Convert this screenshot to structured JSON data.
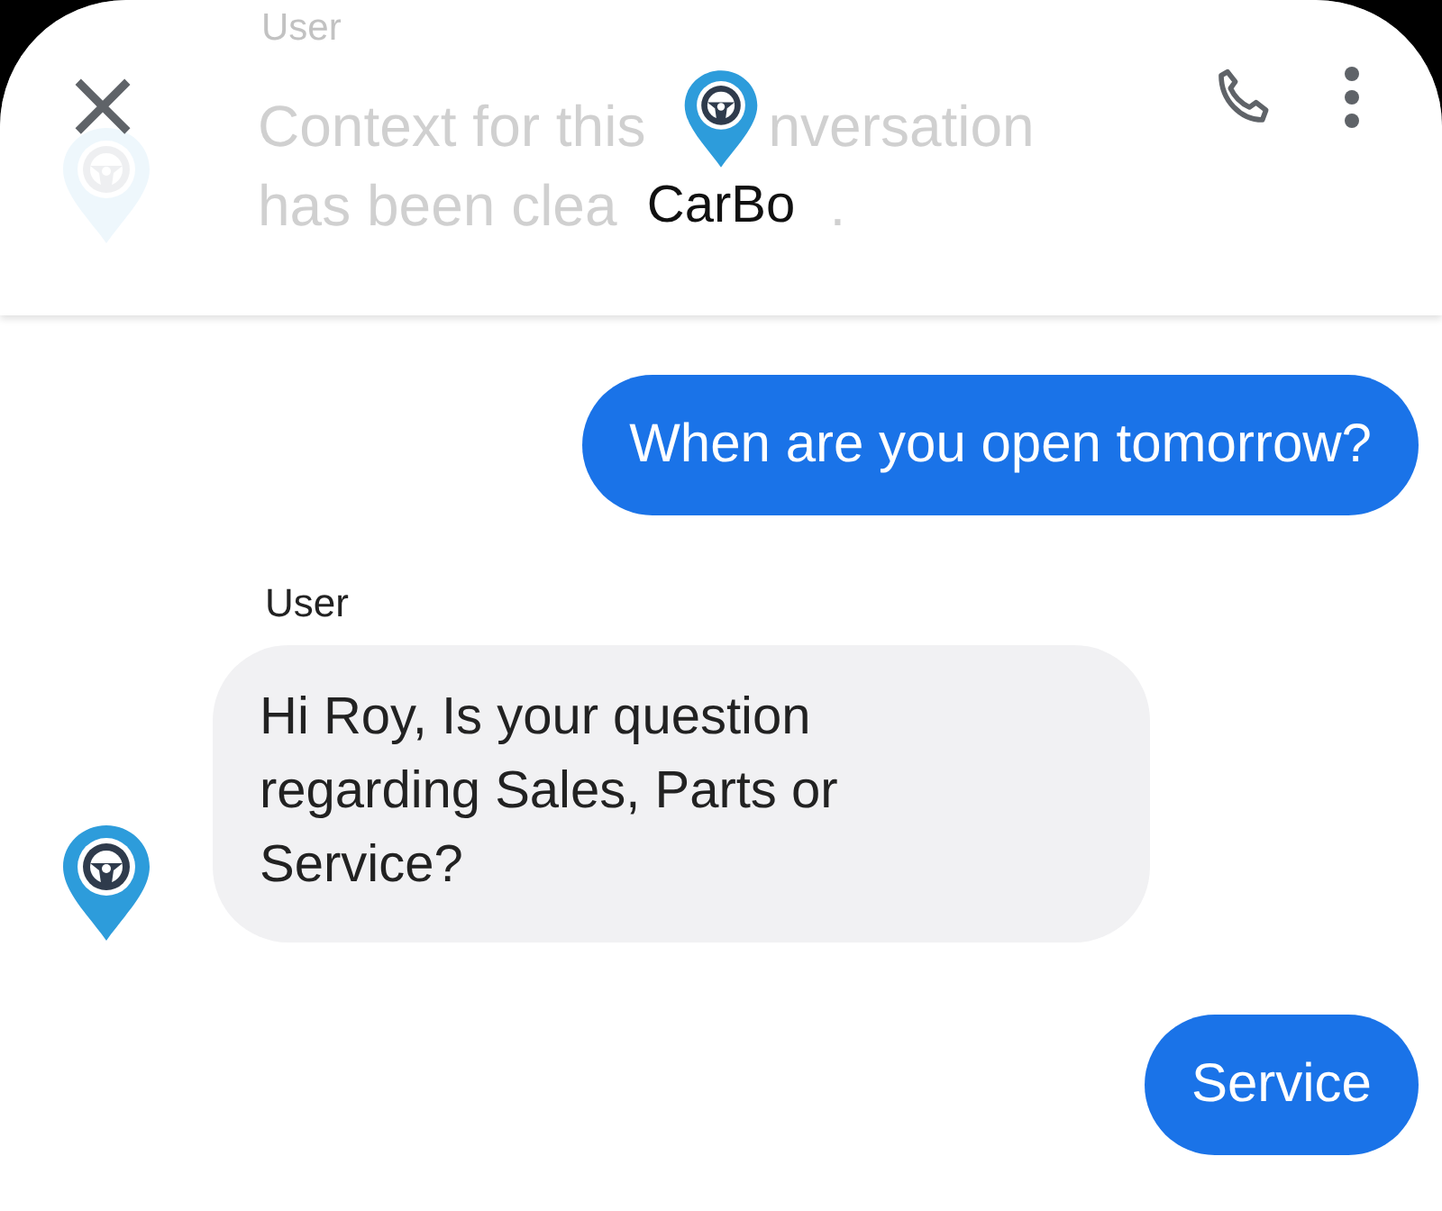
{
  "header": {
    "title": "CarBo",
    "close_icon": "×"
  },
  "faded_message": {
    "sender": "User",
    "line_1": [
      "Context for this",
      "nversation"
    ],
    "line_2": [
      "has been clea",
      "."
    ]
  },
  "messages": [
    {
      "kind": "outgoing",
      "text": "When are you open tomorrow?"
    },
    {
      "kind": "incoming",
      "sender": "User",
      "text": "Hi Roy, Is your question regarding Sales, Parts or Service?"
    },
    {
      "kind": "outgoing",
      "text": "Service"
    }
  ]
}
